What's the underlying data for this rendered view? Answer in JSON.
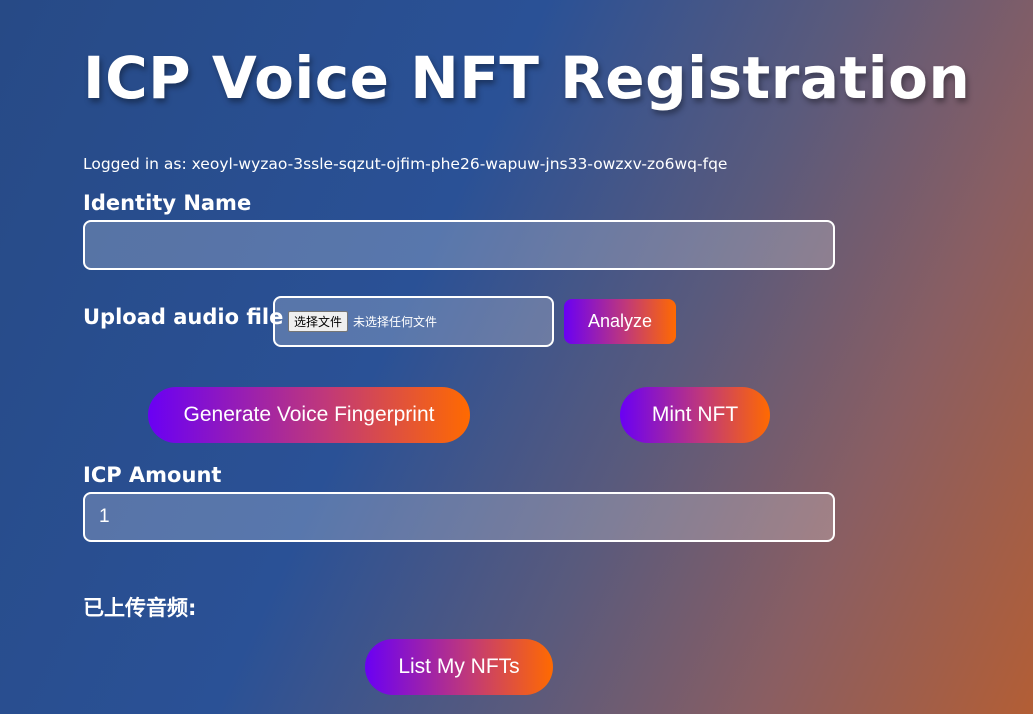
{
  "page": {
    "title": "ICP Voice NFT Registration",
    "login_text": "Logged in as: xeoyl-wyzao-3ssle-sqzut-ojfim-phe26-wapuw-jns33-owzxv-zo6wq-fqe"
  },
  "identity": {
    "label": "Identity Name",
    "value": ""
  },
  "upload": {
    "label": "Upload audio file",
    "choose_button": "选择文件",
    "status": "未选择任何文件",
    "analyze_button": "Analyze"
  },
  "actions": {
    "generate_button": "Generate Voice Fingerprint",
    "mint_button": "Mint NFT"
  },
  "icp": {
    "label": "ICP Amount",
    "value": "1"
  },
  "uploaded": {
    "heading": "已上传音频:"
  },
  "list": {
    "button": "List My NFTs"
  },
  "colors": {
    "gradient_start": "#6a00f4",
    "gradient_end": "#ff6a00",
    "background_start": "#274a86",
    "background_end": "#b35e35"
  }
}
